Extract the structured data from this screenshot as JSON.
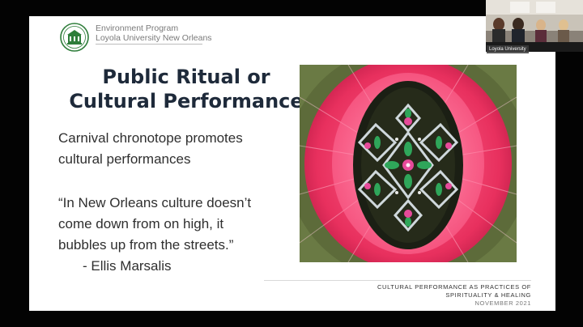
{
  "slide": {
    "org_lines": [
      "Environment Program",
      "Loyola University New Orleans"
    ],
    "title_lines": [
      "Public Ritual or",
      "Cultural Performance"
    ],
    "body_lines": [
      "Carnival chronotope promotes",
      "cultural performances"
    ],
    "quote_lines": [
      "“In New Orleans culture doesn’t",
      "come down from on high, it",
      "bubbles up from the streets.”"
    ],
    "attribution": "- Ellis Marsalis",
    "footer_lines": [
      "CULTURAL PERFORMANCE AS PRACTICES OF",
      "SPIRITUALITY & HEALING"
    ],
    "footer_date": "NOVEMBER 2021",
    "image": "mardi-gras-indian-beadwork-suit-photo",
    "logo": "loyola-university-seal-icon"
  },
  "video_gallery": {
    "participant_label": "Loyola University"
  },
  "colors": {
    "title": "#1e2a3a",
    "body_text": "#2f2f2f",
    "org_text": "#7a7a7a",
    "logo_green": "#2e7d3a",
    "feather_pink": "#f0426e",
    "feather_olive": "#5d6b3a"
  }
}
